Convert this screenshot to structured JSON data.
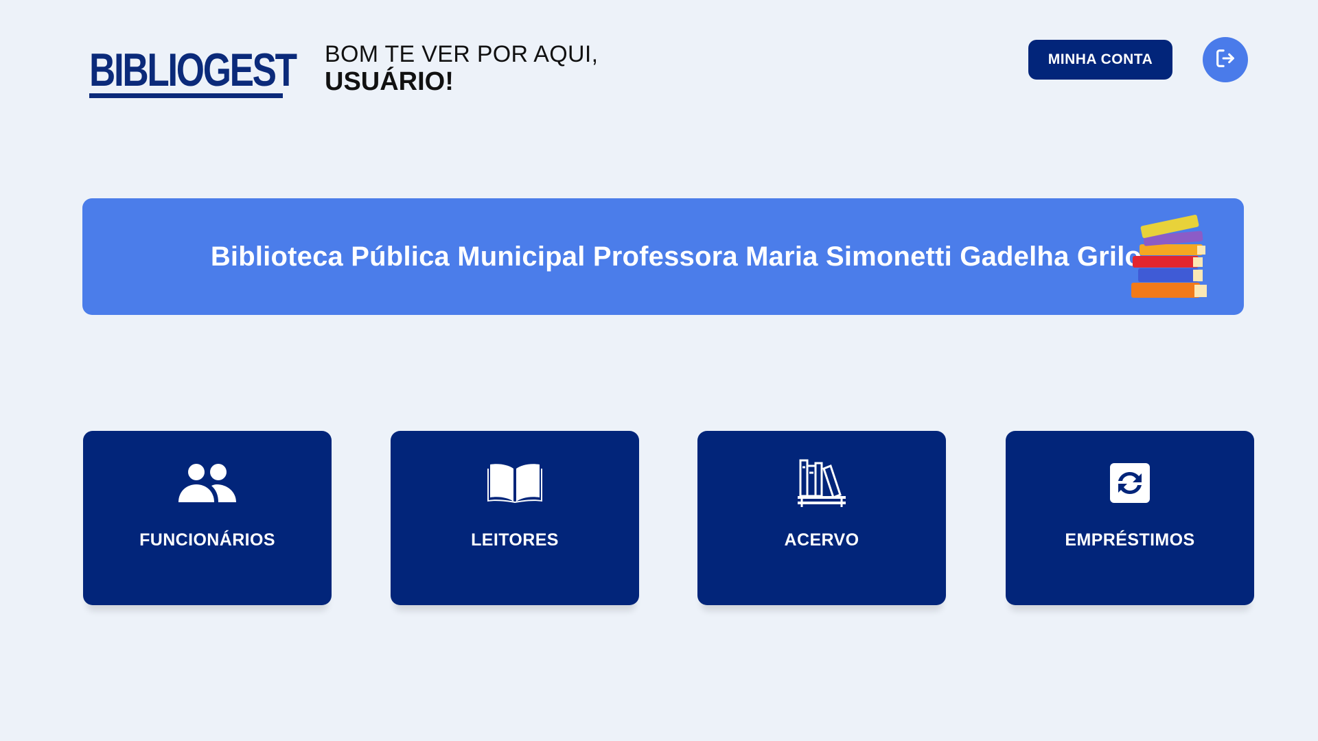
{
  "app": {
    "logo_text": "BIBLIOGEST"
  },
  "header": {
    "greeting_line1": "BOM TE VER POR AQUI,",
    "greeting_line2": "USUÁRIO!",
    "account_button_label": "MINHA CONTA",
    "logout_icon": "logout-icon"
  },
  "banner": {
    "title": "Biblioteca Pública Municipal Professora Maria Simonetti Gadelha Grilo",
    "illustration": "book-stack"
  },
  "menu": {
    "items": [
      {
        "label": "FUNCIONÁRIOS",
        "icon": "users-icon"
      },
      {
        "label": "LEITORES",
        "icon": "open-book-icon"
      },
      {
        "label": "ACERVO",
        "icon": "bookshelf-icon"
      },
      {
        "label": "EMPRÉSTIMOS",
        "icon": "exchange-icon"
      }
    ]
  },
  "colors": {
    "background": "#edf2f9",
    "primary": "#02257a",
    "accent": "#4b7dea"
  }
}
